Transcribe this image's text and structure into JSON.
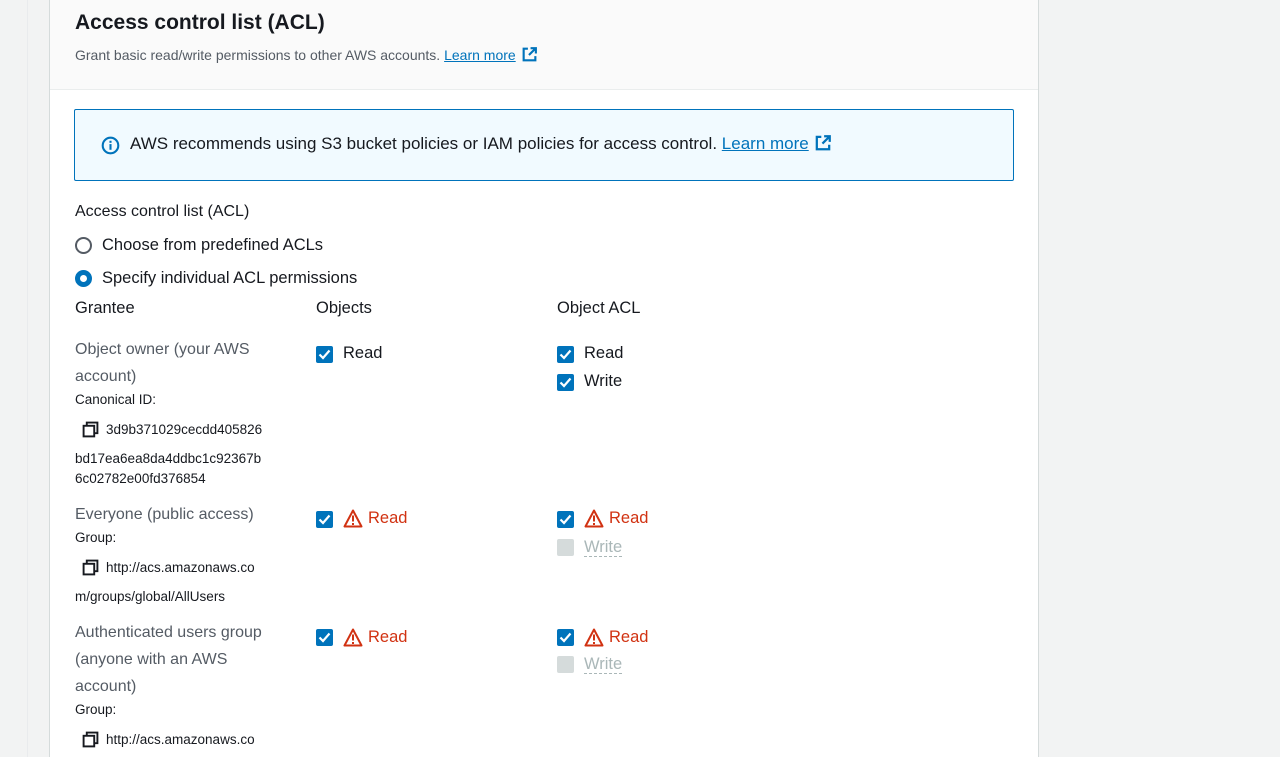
{
  "section": {
    "title": "Access control list (ACL)",
    "subtitle": "Grant basic read/write permissions to other AWS accounts.",
    "learn_more": "Learn more"
  },
  "alert": {
    "text": "AWS recommends using S3 bucket policies or IAM policies for access control.",
    "learn_more": "Learn more"
  },
  "acl": {
    "label": "Access control list (ACL)",
    "options": [
      {
        "label": "Choose from predefined ACLs",
        "selected": false
      },
      {
        "label": "Specify individual ACL permissions",
        "selected": true
      }
    ]
  },
  "table": {
    "headers": [
      "Grantee",
      "Objects",
      "Object ACL"
    ],
    "rows": [
      {
        "grantee_lines": [
          "Object owner (your AWS",
          "account)"
        ],
        "id_label": "Canonical ID:",
        "id_lines": [
          "3d9b371029cecdd405826",
          "bd17ea6ea8da4ddbc1c92367b",
          "6c02782e00fd376854"
        ],
        "objects": [
          {
            "label": "Read",
            "checked": true,
            "warning": false
          }
        ],
        "object_acl": [
          {
            "label": "Read",
            "checked": true,
            "warning": false
          },
          {
            "label": "Write",
            "checked": true,
            "warning": false
          }
        ]
      },
      {
        "grantee_lines": [
          "Everyone (public access)"
        ],
        "id_label": "Group:",
        "id_lines": [
          "http://acs.amazonaws.co",
          "m/groups/global/AllUsers"
        ],
        "objects": [
          {
            "label": "Read",
            "checked": true,
            "warning": true
          }
        ],
        "object_acl": [
          {
            "label": "Read",
            "checked": true,
            "warning": true
          },
          {
            "label": "Write",
            "checked": false,
            "disabled": true
          }
        ]
      },
      {
        "grantee_lines": [
          "Authenticated users group",
          "(anyone with an AWS",
          "account)"
        ],
        "id_label": "Group:",
        "id_lines": [
          "http://acs.amazonaws.co"
        ],
        "objects": [
          {
            "label": "Read",
            "checked": true,
            "warning": true
          }
        ],
        "object_acl": [
          {
            "label": "Read",
            "checked": true,
            "warning": true
          },
          {
            "label": "Write",
            "checked": false,
            "disabled": true
          }
        ]
      }
    ]
  },
  "icons": {
    "external": "external-link-icon",
    "info": "info-icon",
    "copy": "copy-icon",
    "warning": "warning-icon",
    "check": "check-icon"
  },
  "colors": {
    "accent": "#0073bb",
    "warning": "#d13212",
    "alert_bg": "#f1faff",
    "disabled": "#d5dbdb"
  }
}
